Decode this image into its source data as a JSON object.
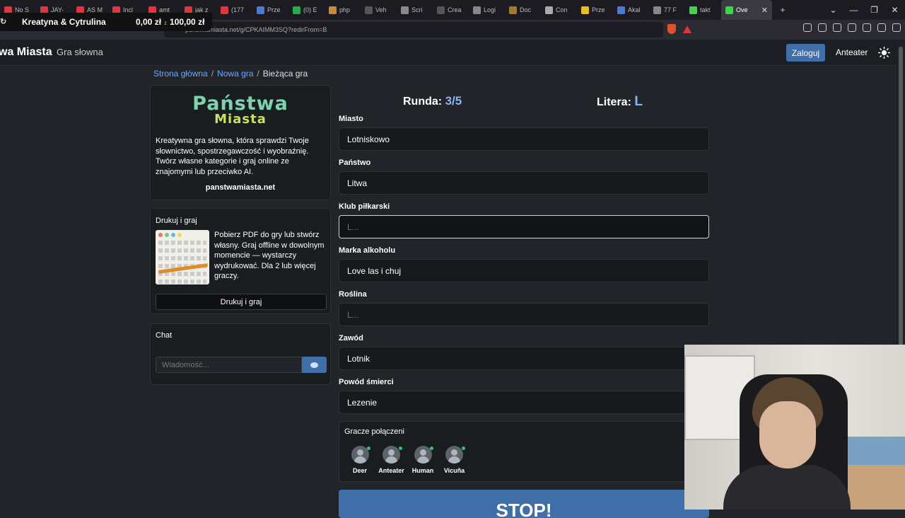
{
  "browser": {
    "tabs": [
      {
        "label": "No S",
        "color": "#e2343f"
      },
      {
        "label": "JAY-",
        "color": "#e2343f"
      },
      {
        "label": "AS M",
        "color": "#e2343f"
      },
      {
        "label": "Incl",
        "color": "#e2343f"
      },
      {
        "label": "amt",
        "color": "#e2343f"
      },
      {
        "label": "jak z",
        "color": "#e2343f"
      },
      {
        "label": "(177",
        "color": "#e2343f"
      },
      {
        "label": "Prze",
        "color": "#4a7bd0"
      },
      {
        "label": "(0) E",
        "color": "#29a84f"
      },
      {
        "label": "php",
        "color": "#c88a3a"
      },
      {
        "label": "Veh",
        "color": "#555"
      },
      {
        "label": "Scri",
        "color": "#888"
      },
      {
        "label": "Crea",
        "color": "#555"
      },
      {
        "label": "Logi",
        "color": "#888"
      },
      {
        "label": "Doc",
        "color": "#a07a30"
      },
      {
        "label": "Con",
        "color": "#aaa"
      },
      {
        "label": "Prze",
        "color": "#e8c020"
      },
      {
        "label": "Akal",
        "color": "#4a7bd0"
      },
      {
        "label": "77 F",
        "color": "#888"
      },
      {
        "label": "takt",
        "color": "#3fd44a"
      },
      {
        "label": "Ove",
        "color": "#3fd44a"
      }
    ],
    "url": "panstwamiasta.net/g/CPKAIMM3SQ?redirFrom=B"
  },
  "overlay": {
    "title": "Kreatyna & Cytrulina",
    "current": "0,00 zł",
    "separator": "z",
    "goal": "100,00 zł"
  },
  "header": {
    "brand": "wa Miasta",
    "brand_sub": "Gra słowna",
    "login_label": "Zaloguj",
    "user_name": "Anteater"
  },
  "breadcrumb": {
    "home": "Strona główna",
    "new_game": "Nowa gra",
    "current": "Bieżąca gra"
  },
  "sidebar": {
    "logo_line1": "Państwa",
    "logo_line2": "Miasta",
    "description": "Kreatywna gra słowna, która sprawdzi Twoje słownictwo, spostrzegawczość i wyobraźnię. Twórz własne kategorie i graj online ze znajomymi lub przeciwko AI.",
    "site_link": "panstwamiasta.net",
    "print_title": "Drukuj i graj",
    "print_desc": "Pobierz PDF do gry lub stwórz własny. Graj offline w dowolnym momencie — wystarczy wydrukować. Dla 2 lub więcej graczy.",
    "print_button": "Drukuj i graj",
    "chat_title": "Chat",
    "chat_placeholder": "Wiadomość..."
  },
  "game": {
    "round_label": "Runda:",
    "round_value": "3/5",
    "letter_label": "Litera:",
    "letter_value": "L",
    "fields": [
      {
        "label": "Miasto",
        "value": "Lotniskowo",
        "placeholder": "L..."
      },
      {
        "label": "Państwo",
        "value": "Litwa",
        "placeholder": "L..."
      },
      {
        "label": "Klub piłkarski",
        "value": "",
        "placeholder": "L..."
      },
      {
        "label": "Marka alkoholu",
        "value": "Love las i chuj",
        "placeholder": "L..."
      },
      {
        "label": "Roślina",
        "value": "",
        "placeholder": "L..."
      },
      {
        "label": "Zawód",
        "value": "Lotnik",
        "placeholder": "L..."
      },
      {
        "label": "Powód śmierci",
        "value": "Lezenie",
        "placeholder": "L..."
      }
    ],
    "players_title": "Gracze połączeni",
    "players": [
      "Deer",
      "Anteater",
      "Human",
      "Vicuña"
    ],
    "stop_label": "STOP!"
  }
}
